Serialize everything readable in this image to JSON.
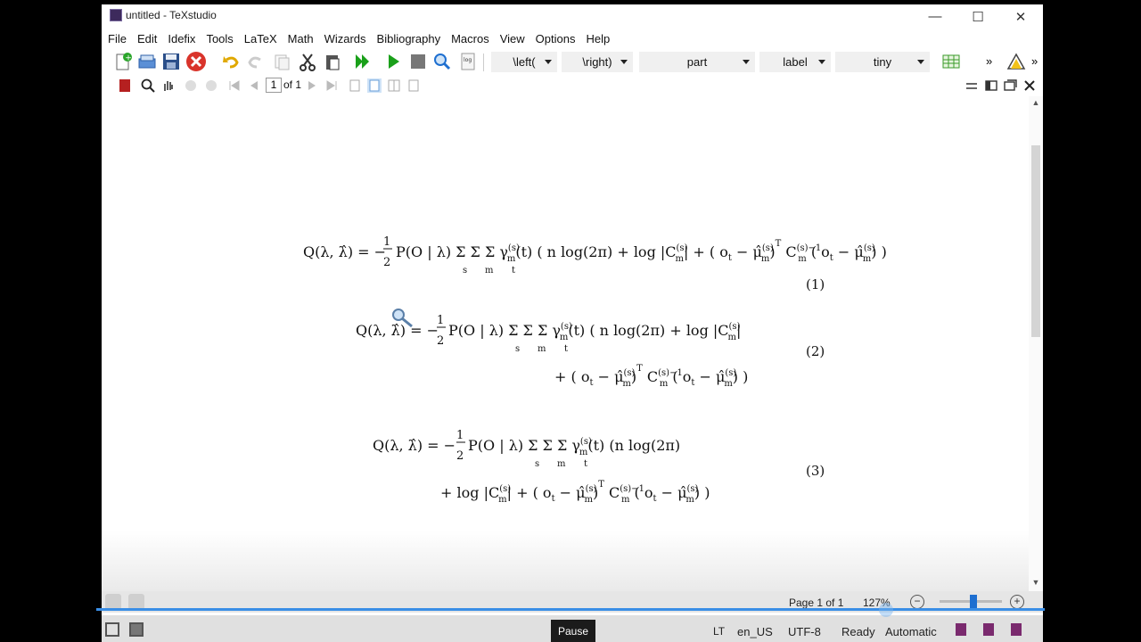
{
  "window": {
    "title": "untitled - TeXstudio",
    "minimize": "—",
    "maximize": "☐",
    "close": "✕"
  },
  "menu": [
    "File",
    "Edit",
    "Idefix",
    "Tools",
    "LaTeX",
    "Math",
    "Wizards",
    "Bibliography",
    "Macros",
    "View",
    "Options",
    "Help"
  ],
  "toolbar": {
    "combos": [
      "\\left(",
      "\\right)",
      "part",
      "label",
      "tiny"
    ],
    "overflow": "»"
  },
  "viewer_toolbar": {
    "page_input": "1",
    "page_of": "of 1"
  },
  "equations": [
    {
      "number": "(1)",
      "line1": "Q(λ, λ̂) = −½P(O | λ) Σ_s Σ_m Σ_t γ_m^(s)(t) ( n log(2π) + log |C_m^(s)| + (o_t − μ̂_m^(s))^T C_m^(s)−1 (o_t − μ̂_m^(s)) )"
    },
    {
      "number": "(2)",
      "line1": "Q(λ, λ̂) = −½P(O | λ) Σ_s Σ_m Σ_t γ_m^(s)(t) ( n log(2π) + log |C_m^(s)|",
      "line2": "+ (o_t − μ̂_m^(s))^T C_m^(s)−1 (o_t − μ̂_m^(s)) )"
    },
    {
      "number": "(3)",
      "line1": "Q(λ, λ̂) = −½P(O | λ) Σ_s Σ_m Σ_t γ_m^(s)(t) (n log(2π)",
      "line2": "+ log |C_m^(s)| + (o_t − μ̂_m^(s))^T C_m^(s)−1 (o_t − μ̂_m^(s)) )"
    }
  ],
  "viewer_status": {
    "page": "Page 1 of 1",
    "zoom": "127%",
    "zoom_minus": "−",
    "zoom_plus": "+",
    "zoom_level_fraction": 0.5
  },
  "statusbar": {
    "lt": "LT",
    "language": "en_US",
    "encoding": "UTF-8",
    "state": "Ready",
    "mode": "Automatic"
  },
  "video": {
    "pause_label": "Pause"
  },
  "colors": {
    "accent": "#1e6fd0",
    "run_green": "#1aa01a",
    "stop_red": "#d9342b"
  }
}
